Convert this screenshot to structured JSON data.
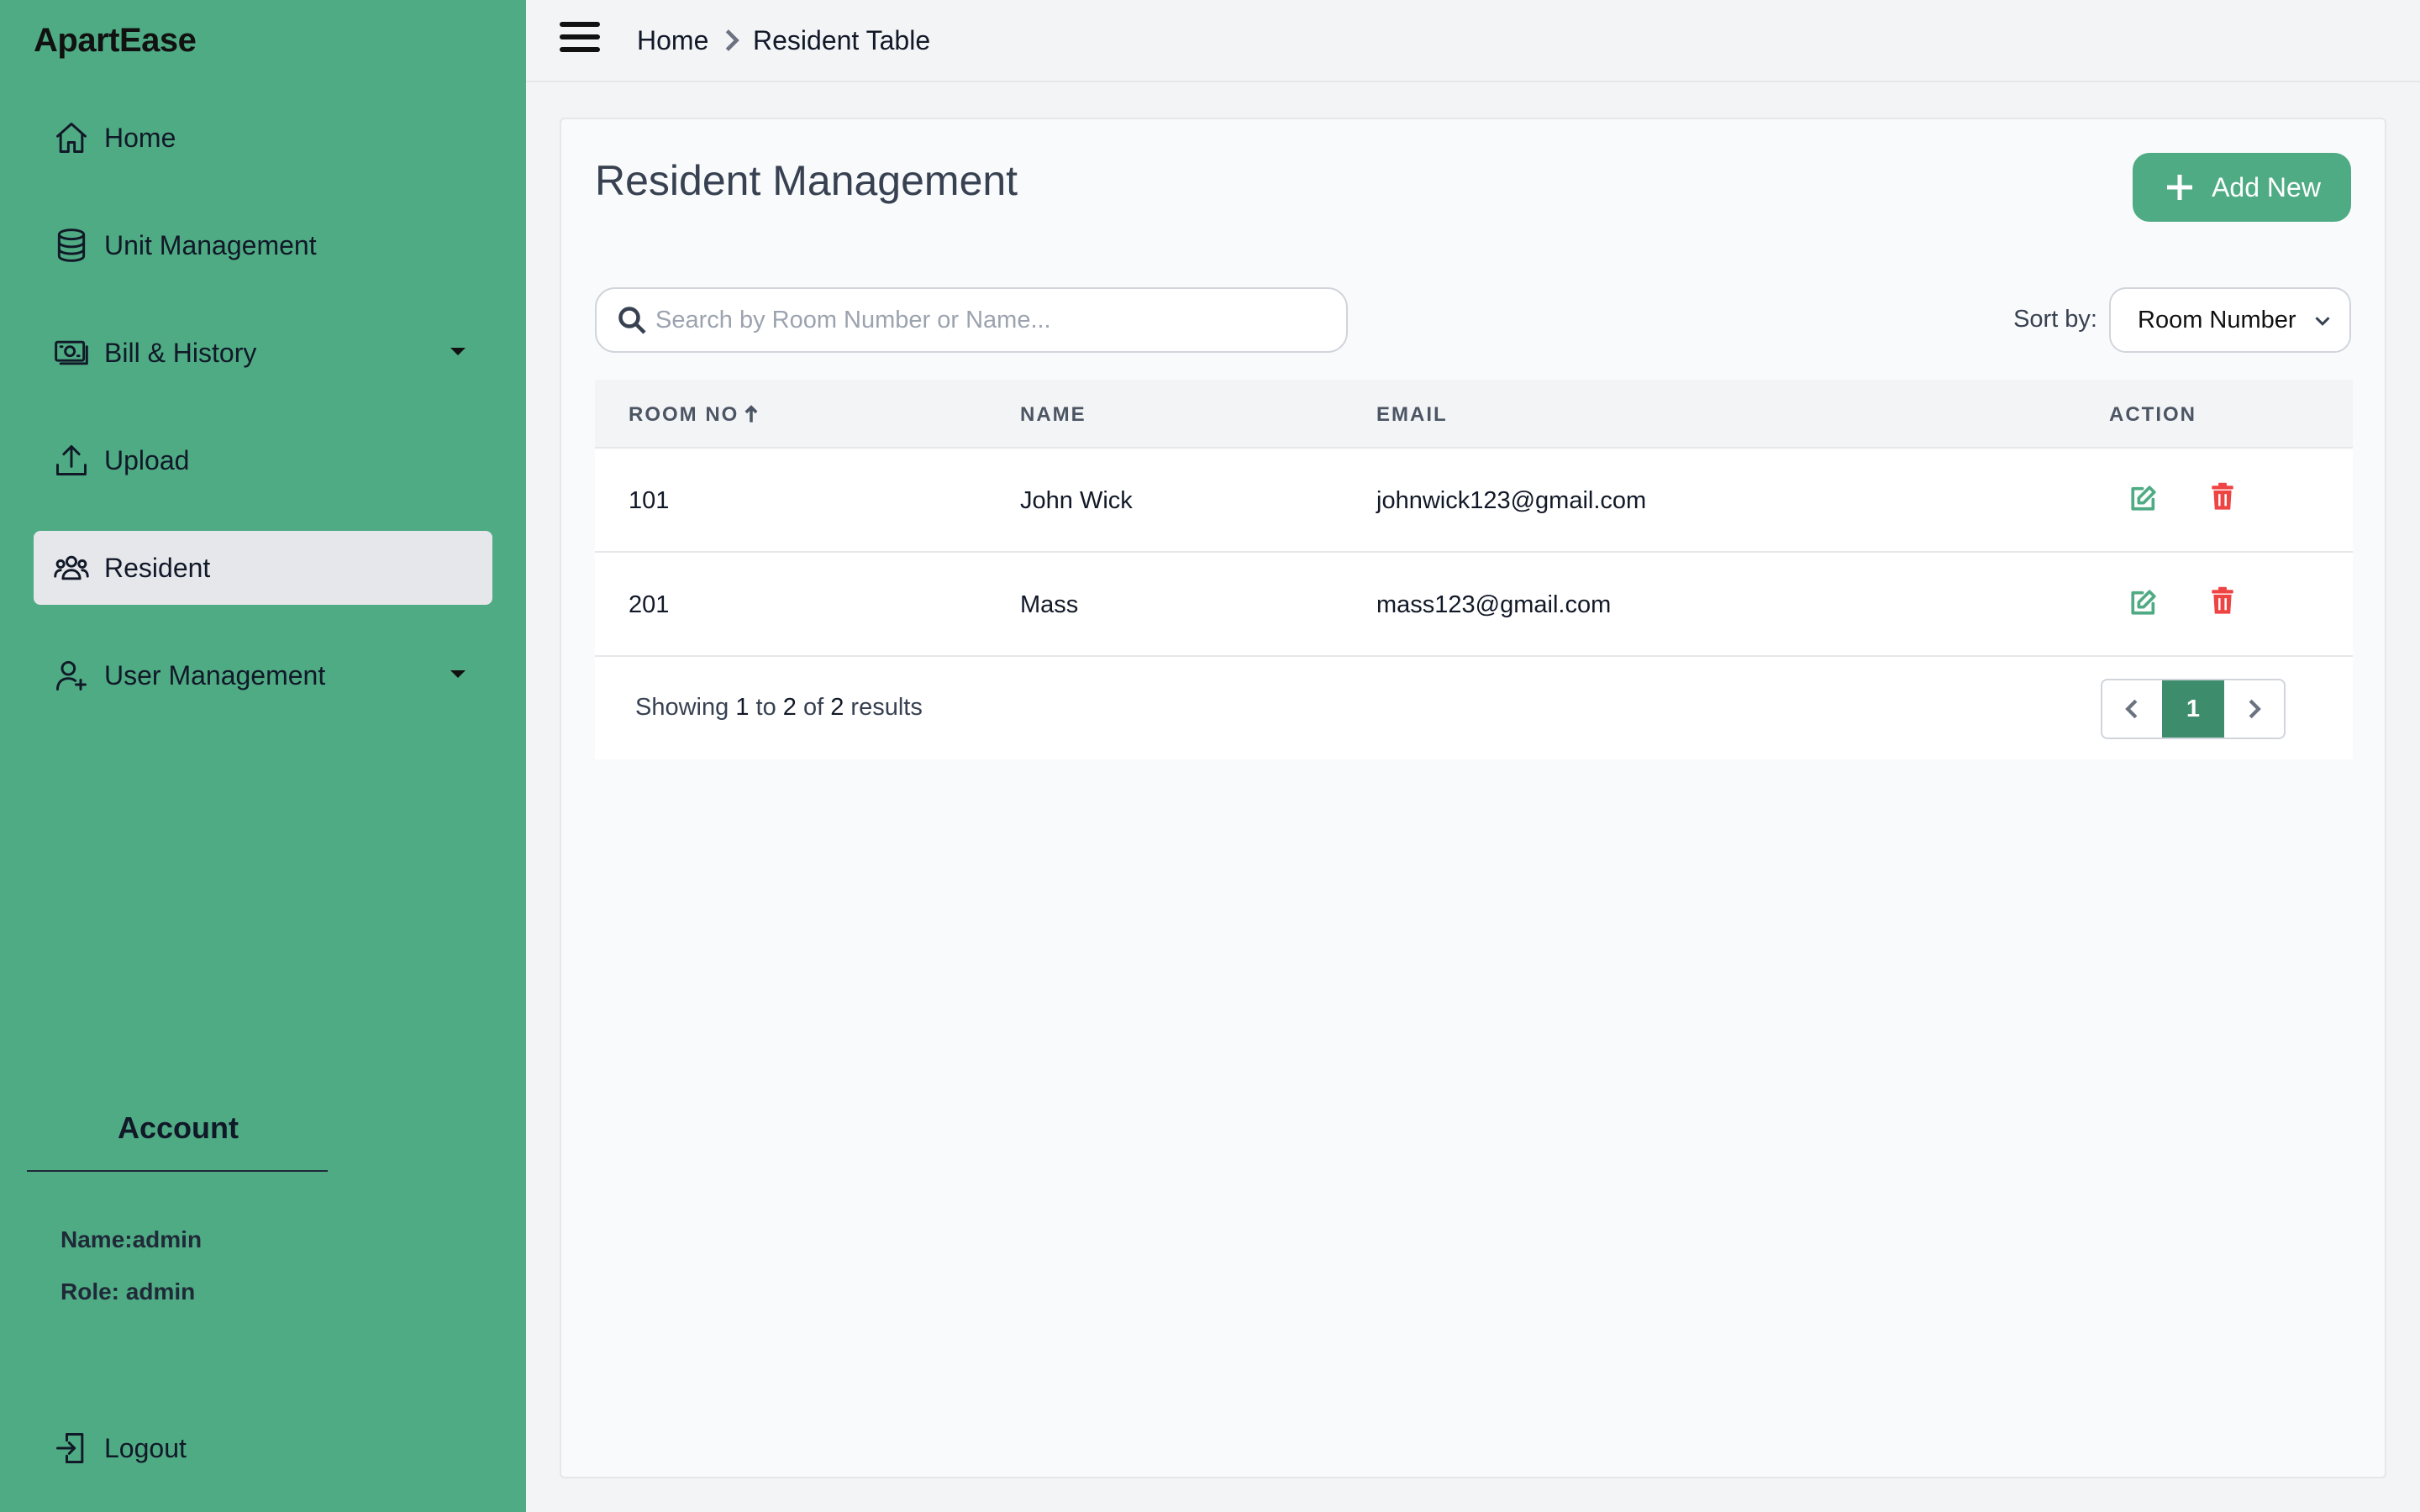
{
  "app": {
    "brand": "ApartEase"
  },
  "sidebar": {
    "items": [
      {
        "label": "Home",
        "icon": "home-icon"
      },
      {
        "label": "Unit Management",
        "icon": "database-icon"
      },
      {
        "label": "Bill & History",
        "icon": "money-icon",
        "has_dropdown": true
      },
      {
        "label": "Upload",
        "icon": "upload-icon"
      },
      {
        "label": "Resident",
        "icon": "users-icon",
        "active": true
      },
      {
        "label": "User Management",
        "icon": "user-plus-icon",
        "has_dropdown": true
      }
    ],
    "account": {
      "title": "Account",
      "name": "Name:admin",
      "role": "Role: admin"
    },
    "logout": "Logout"
  },
  "breadcrumb": {
    "home": "Home",
    "current": "Resident Table"
  },
  "main": {
    "title": "Resident Management",
    "add_button": "Add New",
    "search": {
      "placeholder": "Search by Room Number or Name...",
      "value": ""
    },
    "sort": {
      "label": "Sort by:",
      "value": "Room Number"
    },
    "table": {
      "columns": [
        "ROOM NO",
        "NAME",
        "EMAIL",
        "ACTION"
      ],
      "sort_indicator": "ascending",
      "rows": [
        {
          "room": "101",
          "name": "John Wick",
          "email": "johnwick123@gmail.com"
        },
        {
          "room": "201",
          "name": "Mass",
          "email": "mass123@gmail.com"
        }
      ]
    },
    "footer": {
      "showing_prefix": "Showing",
      "from": "1",
      "to_word": "to",
      "to": "2",
      "of_word": "of",
      "total": "2",
      "suffix": "results",
      "current_page": "1"
    }
  },
  "colors": {
    "sidebar": "#4fab84",
    "accent": "#4fab84",
    "page_active": "#3d8c6b",
    "delete": "#ef4444"
  }
}
